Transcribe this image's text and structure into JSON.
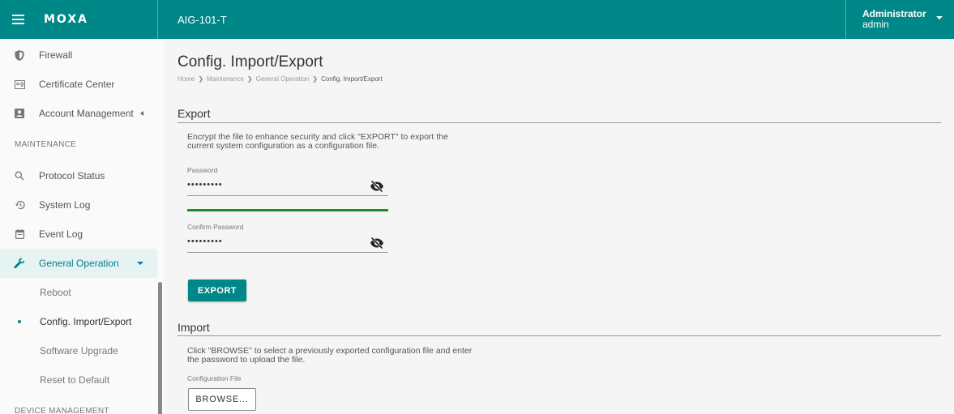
{
  "header": {
    "logo": "MOXA",
    "device_name": "AIG-101-T",
    "user_role": "Administrator",
    "user_name": "admin"
  },
  "sidebar": {
    "items_top": [
      {
        "label": "Firewall",
        "icon": "shield-icon"
      },
      {
        "label": "Certificate Center",
        "icon": "certificate-icon"
      },
      {
        "label": "Account Management",
        "icon": "account-box-icon"
      }
    ],
    "maintenance_header": "MAINTENANCE",
    "maintenance_items": [
      {
        "label": "Protocol Status",
        "icon": "search-icon"
      },
      {
        "label": "System Log",
        "icon": "history-icon"
      },
      {
        "label": "Event Log",
        "icon": "calendar-icon"
      },
      {
        "label": "General Operation",
        "icon": "wrench-icon"
      }
    ],
    "sub_items": [
      "Reboot",
      "Config. Import/Export",
      "Software Upgrade",
      "Reset to Default"
    ],
    "device_management_header": "DEVICE MANAGEMENT"
  },
  "page": {
    "title": "Config. Import/Export",
    "breadcrumb": [
      "Home",
      "Maintenance",
      "General Operation",
      "Config. Import/Export"
    ]
  },
  "export": {
    "title": "Export",
    "description_line1": "Encrypt the file to enhance security and click \"EXPORT\" to export the",
    "description_line2": "current system configuration as a configuration file.",
    "password_label": "Password",
    "password_value": "•••••••••",
    "confirm_label": "Confirm Password",
    "confirm_value": "•••••••••",
    "strength_fraction": 1.0,
    "button_label": "EXPORT"
  },
  "import": {
    "title": "Import",
    "description_line1": "Click \"BROWSE\" to select a previously exported configuration file and enter",
    "description_line2": "the password to upload the file.",
    "file_label": "Configuration File",
    "button_label": "BROWSE..."
  },
  "colors": {
    "brand": "#008787",
    "strength_bar": "#1e8a2a"
  }
}
